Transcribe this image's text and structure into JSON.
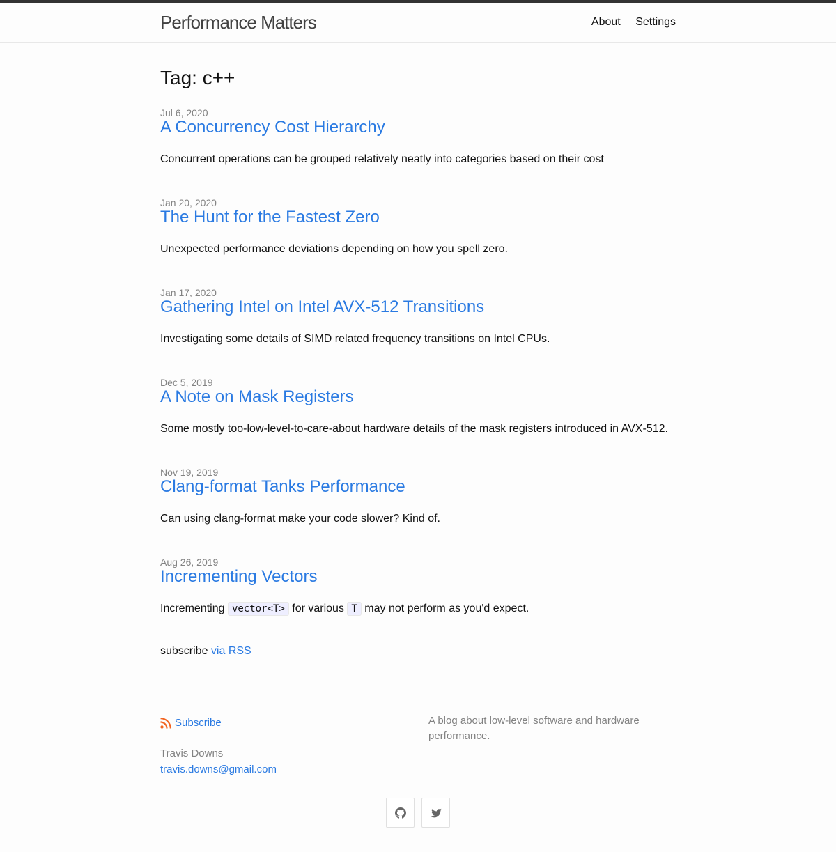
{
  "header": {
    "site_title": "Performance Matters",
    "nav": [
      "About",
      "Settings"
    ]
  },
  "page": {
    "heading": "Tag: c++",
    "posts": [
      {
        "date": "Jul 6, 2020",
        "title": "A Concurrency Cost Hierarchy",
        "excerpt": "Concurrent operations can be grouped relatively neatly into categories based on their cost"
      },
      {
        "date": "Jan 20, 2020",
        "title": "The Hunt for the Fastest Zero",
        "excerpt": "Unexpected performance deviations depending on how you spell zero."
      },
      {
        "date": "Jan 17, 2020",
        "title": "Gathering Intel on Intel AVX-512 Transitions",
        "excerpt": "Investigating some details of SIMD related frequency transitions on Intel CPUs."
      },
      {
        "date": "Dec 5, 2019",
        "title": "A Note on Mask Registers",
        "excerpt": "Some mostly too-low-level-to-care-about hardware details of the mask registers introduced in AVX-512."
      },
      {
        "date": "Nov 19, 2019",
        "title": "Clang-format Tanks Performance",
        "excerpt": "Can using clang-format make your code slower? Kind of."
      },
      {
        "date": "Aug 26, 2019",
        "title": "Incrementing Vectors",
        "excerpt_parts": [
          "Incrementing ",
          "vector<T>",
          " for various ",
          "T",
          " may not perform as you'd expect."
        ]
      }
    ],
    "rss_prefix": "subscribe ",
    "rss_link": "via RSS"
  },
  "footer": {
    "subscribe_label": "Subscribe",
    "author_name": "Travis Downs",
    "author_email": "travis.downs@gmail.com",
    "description": "A blog about low-level software and hardware performance.",
    "social_icons": [
      "github-icon",
      "twitter-icon"
    ]
  },
  "colors": {
    "link": "#2a7ae2",
    "muted": "#828282",
    "rss": "#f26522"
  }
}
